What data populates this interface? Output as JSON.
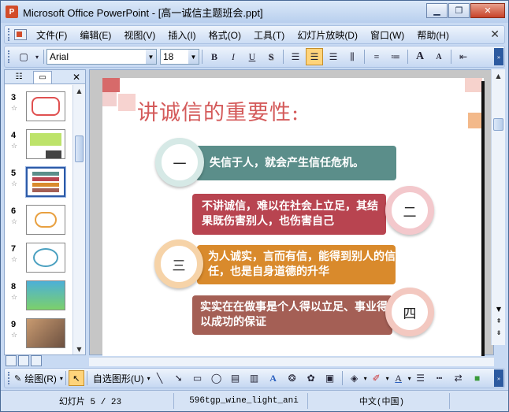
{
  "window": {
    "title": "Microsoft Office PowerPoint - [高一诚信主题班会.ppt]",
    "app_icon": "P"
  },
  "menu": [
    "文件(F)",
    "编辑(E)",
    "视图(V)",
    "插入(I)",
    "格式(O)",
    "工具(T)",
    "幻灯片放映(D)",
    "窗口(W)",
    "帮助(H)"
  ],
  "toolbar": {
    "font_name": "Arial",
    "font_size": "18",
    "bold": "B",
    "italic": "I",
    "underline": "U",
    "shadow": "S",
    "grow_font": "A",
    "shrink_font": "A"
  },
  "thumbnails": [
    {
      "num": "3",
      "selected": false
    },
    {
      "num": "4",
      "selected": false
    },
    {
      "num": "5",
      "selected": true
    },
    {
      "num": "6",
      "selected": false
    },
    {
      "num": "7",
      "selected": false
    },
    {
      "num": "8",
      "selected": false
    },
    {
      "num": "9",
      "selected": false
    }
  ],
  "thumb_star": "☆",
  "slide": {
    "title": "讲诚信的重要性:",
    "items": [
      {
        "marker": "一",
        "text": "失信于人，就会产生信任危机。",
        "color": "#5b8e8a"
      },
      {
        "marker": "二",
        "text": "不讲诚信，难以在社会上立足，其结果既伤害别人，也伤害自己",
        "color": "#b84450"
      },
      {
        "marker": "三",
        "text": "为人诚实，言而有信，能得到别人的信任，也是自身道德的升华",
        "color": "#d98a2c"
      },
      {
        "marker": "四",
        "text": "实实在在做事是个人得以立足、事业得以成功的保证",
        "color": "#a45f55"
      }
    ]
  },
  "drawbar": {
    "draw_label": "绘图(R)",
    "autoshape_label": "自选图形(U)"
  },
  "status": {
    "slide": "幻灯片 5 / 23",
    "design": "596tgp_wine_light_ani",
    "language": "中文(中国)"
  }
}
